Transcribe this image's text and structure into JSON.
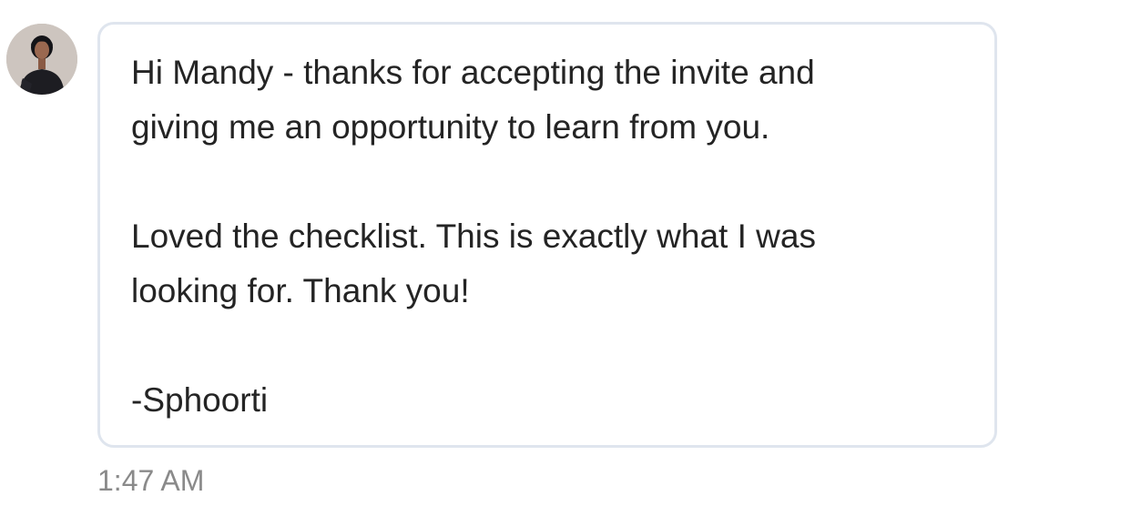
{
  "message": {
    "avatar_icon": "user-avatar-photo",
    "lines": [
      "Hi Mandy - thanks for accepting the invite and",
      "giving me an opportunity to learn from you.",
      "Loved the checklist. This is exactly what I was",
      "looking for. Thank you!",
      "-Sphoorti"
    ],
    "timestamp": "1:47 AM"
  },
  "colors": {
    "bubble_border": "#dfe5ee",
    "text": "#242424",
    "timestamp": "#8a8a8a"
  }
}
